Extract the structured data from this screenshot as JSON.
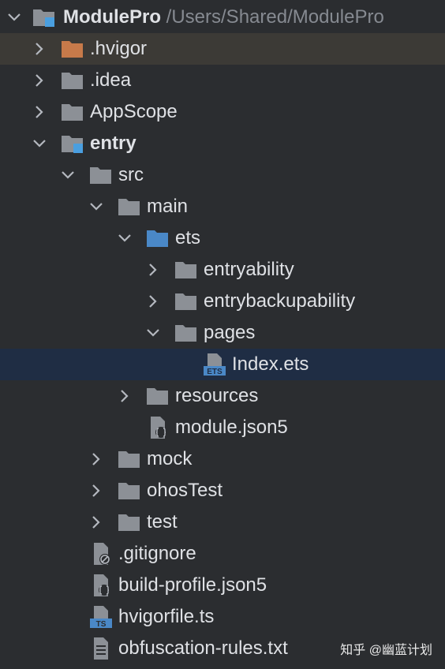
{
  "project": {
    "name": "ModulePro",
    "path": "/Users/Shared/ModulePro"
  },
  "rows": [
    {
      "label": ".hvigor"
    },
    {
      "label": ".idea"
    },
    {
      "label": "AppScope"
    },
    {
      "label": "entry"
    },
    {
      "label": "src"
    },
    {
      "label": "main"
    },
    {
      "label": "ets"
    },
    {
      "label": "entryability"
    },
    {
      "label": "entrybackupability"
    },
    {
      "label": "pages"
    },
    {
      "label": "Index.ets"
    },
    {
      "label": "resources"
    },
    {
      "label": "module.json5"
    },
    {
      "label": "mock"
    },
    {
      "label": "ohosTest"
    },
    {
      "label": "test"
    },
    {
      "label": ".gitignore"
    },
    {
      "label": "build-profile.json5"
    },
    {
      "label": "hvigorfile.ts"
    },
    {
      "label": "obfuscation-rules.txt"
    }
  ],
  "icon_badges": {
    "ets": "ETS",
    "ts": "TS"
  },
  "watermark": "知乎 @幽蓝计划",
  "colors": {
    "background": "#2b2d30",
    "selected": "#1f2d44",
    "folder": "#8c9096",
    "source_folder": "#4a88c7",
    "excluded_folder": "#c77a4a",
    "file_badge": "#4a88c7"
  }
}
